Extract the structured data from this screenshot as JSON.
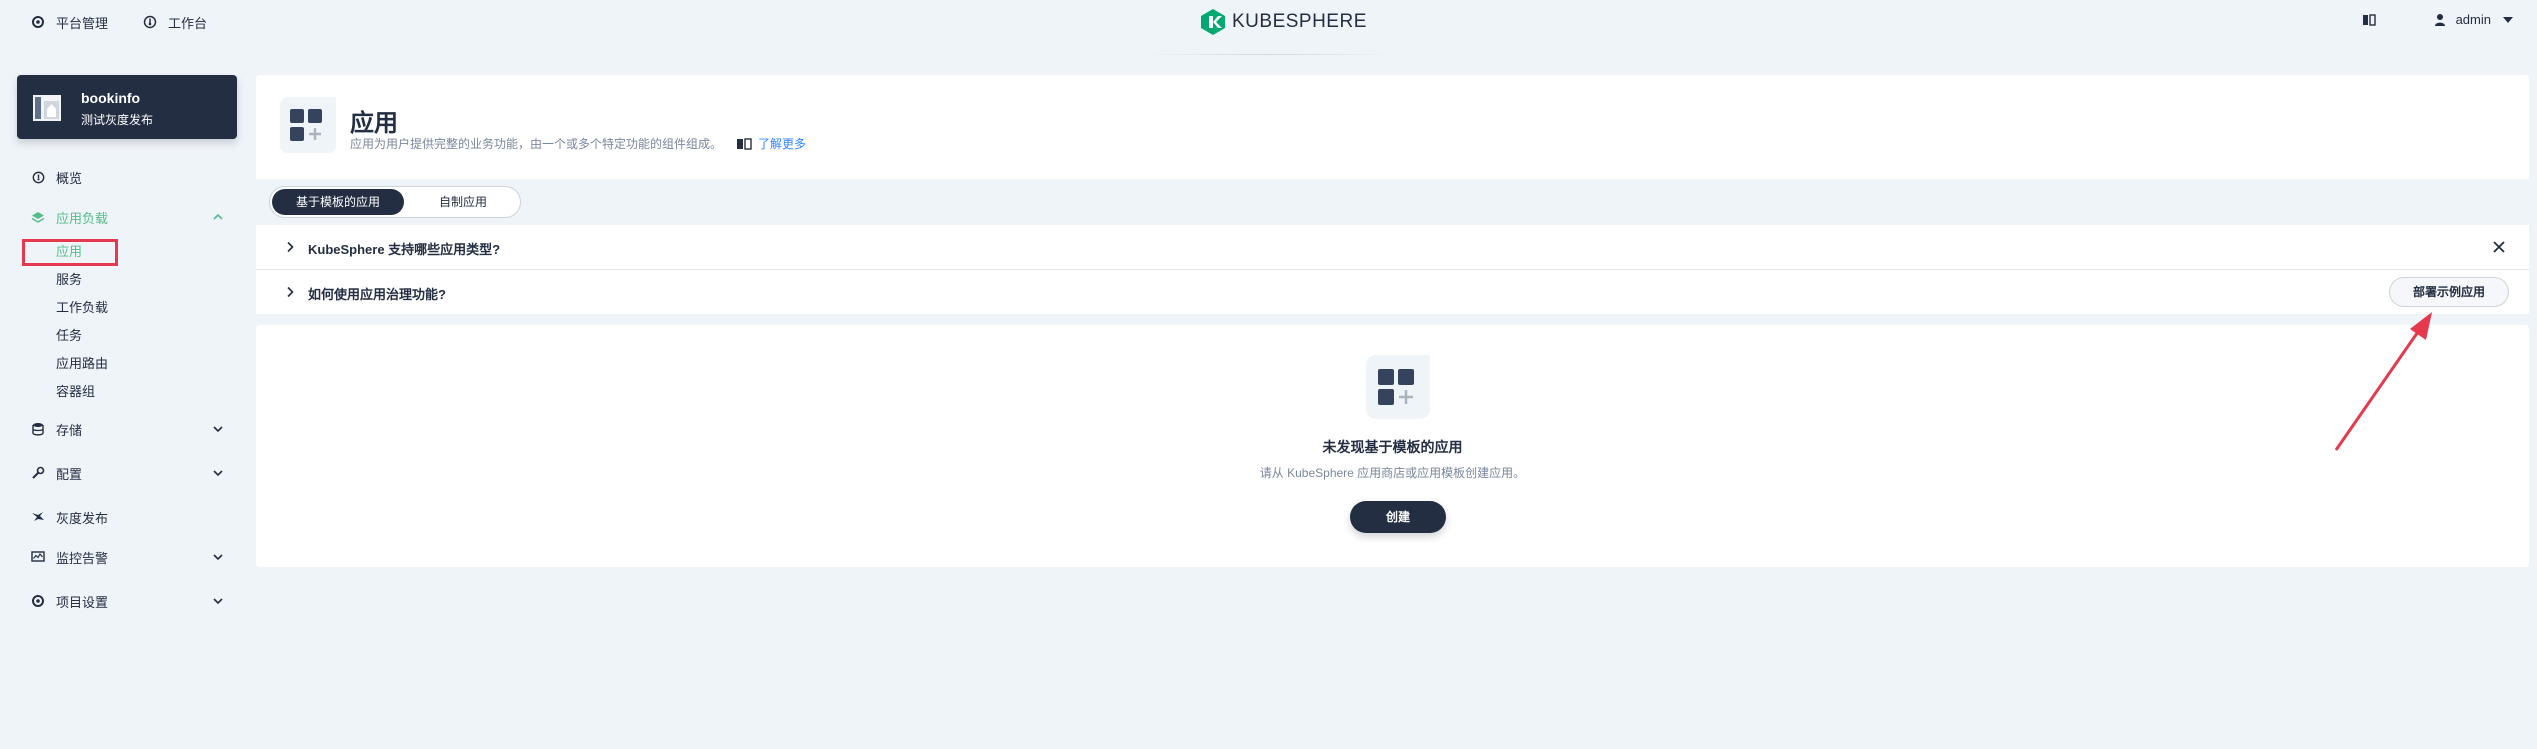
{
  "topbar": {
    "platform_label": "平台管理",
    "workbench_label": "工作台",
    "logo_text": "KUBESPHERE",
    "user_name": "admin"
  },
  "project": {
    "name": "bookinfo",
    "description": "测试灰度发布"
  },
  "sidebar": {
    "overview": "概览",
    "workloads_group": "应用负载",
    "sub_items": [
      "应用",
      "服务",
      "工作负载",
      "任务",
      "应用路由",
      "容器组"
    ],
    "storage": "存储",
    "config": "配置",
    "grayscale": "灰度发布",
    "monitoring": "监控告警",
    "project_settings": "项目设置"
  },
  "header": {
    "title": "应用",
    "description": "应用为用户提供完整的业务功能，由一个或多个特定功能的组件组成。",
    "learn_more": "了解更多"
  },
  "tabs": {
    "template_apps": "基于模板的应用",
    "custom_apps": "自制应用"
  },
  "faq": {
    "q1": "KubeSphere 支持哪些应用类型?",
    "q2": "如何使用应用治理功能?",
    "deploy_sample": "部署示例应用"
  },
  "empty": {
    "title": "未发现基于模板的应用",
    "description": "请从 KubeSphere 应用商店或应用模板创建应用。",
    "create_label": "创建"
  },
  "colors": {
    "accent_green": "#55bc8a",
    "dark": "#242e42",
    "background": "#eff4f9",
    "annotation_red": "#e5394e"
  }
}
